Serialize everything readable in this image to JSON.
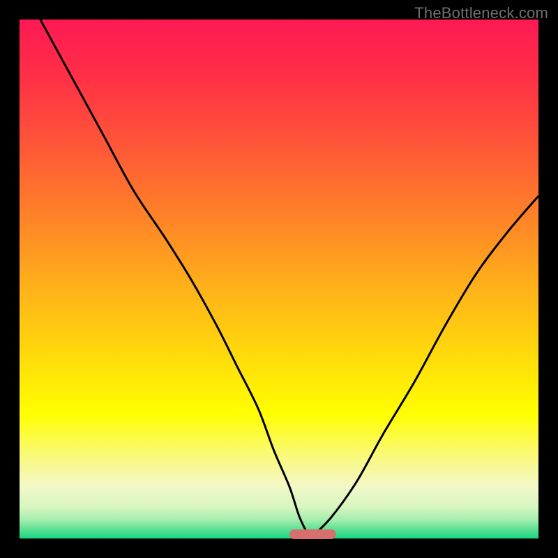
{
  "watermark": "TheBottleneck.com",
  "colors": {
    "black": "#000000",
    "curve": "#000000",
    "marker": "#d6706e"
  },
  "gradient_stops": [
    {
      "offset": 0.0,
      "color": "#ff1954"
    },
    {
      "offset": 0.12,
      "color": "#ff3245"
    },
    {
      "offset": 0.25,
      "color": "#ff5937"
    },
    {
      "offset": 0.38,
      "color": "#ff8228"
    },
    {
      "offset": 0.51,
      "color": "#ffaf1a"
    },
    {
      "offset": 0.64,
      "color": "#ffd80c"
    },
    {
      "offset": 0.76,
      "color": "#ffff00"
    },
    {
      "offset": 0.84,
      "color": "#faf97a"
    },
    {
      "offset": 0.9,
      "color": "#f3f7c8"
    },
    {
      "offset": 0.94,
      "color": "#d6f6c0"
    },
    {
      "offset": 0.965,
      "color": "#a1edad"
    },
    {
      "offset": 0.985,
      "color": "#52df91"
    },
    {
      "offset": 1.0,
      "color": "#18d884"
    }
  ],
  "chart_data": {
    "type": "line",
    "title": "",
    "xlabel": "",
    "ylabel": "",
    "xlim": [
      0,
      100
    ],
    "ylim": [
      0,
      100
    ],
    "minimum_point": {
      "x": 56,
      "y": 0
    },
    "marker": {
      "x_start": 52,
      "x_end": 61,
      "y": 0.8
    },
    "series": [
      {
        "name": "left-branch",
        "x": [
          4,
          10,
          16,
          22,
          28,
          33,
          38,
          42,
          46,
          49,
          52,
          54,
          56
        ],
        "y": [
          100,
          89,
          78,
          67,
          58,
          50,
          41,
          33,
          25,
          17,
          10,
          4,
          0
        ]
      },
      {
        "name": "right-branch",
        "x": [
          56,
          60,
          65,
          70,
          76,
          82,
          88,
          94,
          100
        ],
        "y": [
          0,
          4,
          11,
          20,
          30,
          41,
          51,
          59,
          66
        ]
      }
    ]
  }
}
